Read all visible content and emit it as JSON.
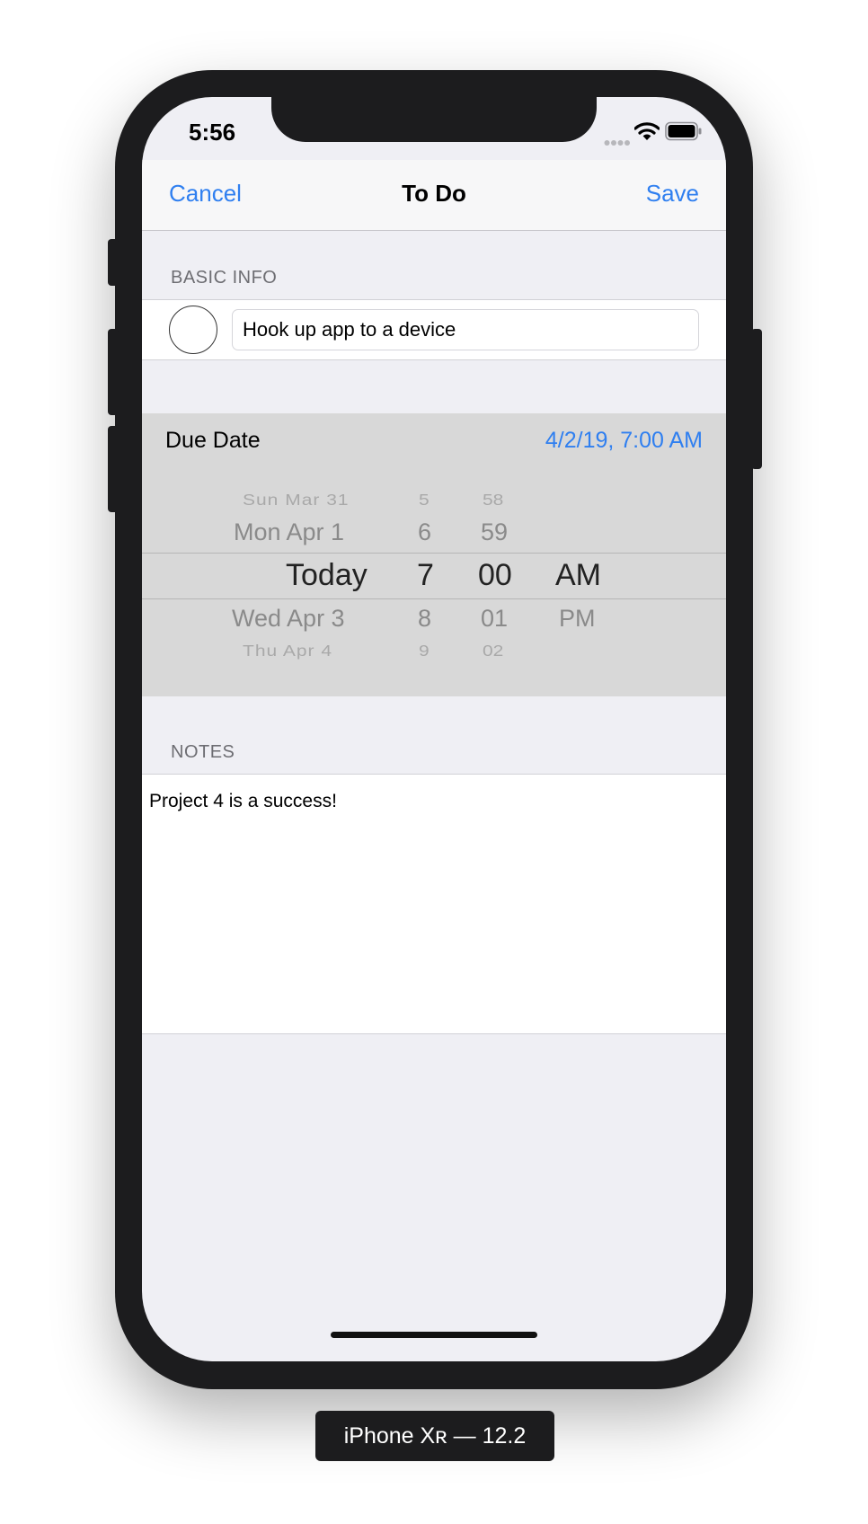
{
  "status_bar": {
    "time": "5:56",
    "icons": [
      "signal-dots-icon",
      "wifi-icon",
      "battery-icon"
    ]
  },
  "nav": {
    "cancel": "Cancel",
    "title": "To Do",
    "save": "Save"
  },
  "basic_info": {
    "header": "BASIC INFO",
    "title_value": "Hook up app to a device",
    "complete_toggle": "empty-circle-icon"
  },
  "due_date": {
    "label": "Due Date",
    "value": "4/2/19, 7:00 AM",
    "picker": {
      "days": [
        "Sun Mar 31",
        "Mon Apr 1",
        "Today",
        "Wed Apr 3",
        "Thu Apr 4"
      ],
      "hours": [
        "5",
        "6",
        "7",
        "8",
        "9"
      ],
      "minutes": [
        "58",
        "59",
        "00",
        "01",
        "02"
      ],
      "periods": [
        "AM",
        "PM"
      ]
    }
  },
  "notes": {
    "header": "NOTES",
    "text": "Project 4 is a success!"
  },
  "device": {
    "label": "iPhone Xʀ — 12.2"
  },
  "colors": {
    "accent": "#2f7ff0",
    "background": "#efeff4",
    "picker_bg": "#d8d8d8"
  }
}
